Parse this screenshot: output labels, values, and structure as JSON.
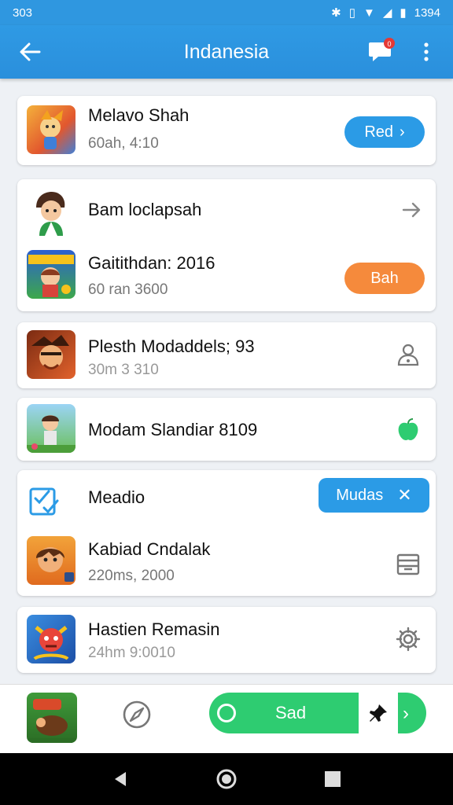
{
  "status_bar": {
    "time": "303",
    "clock": "1394"
  },
  "app_bar": {
    "title": "Indanesia",
    "badge_count": "0"
  },
  "items": [
    {
      "name": "Melavo Shah",
      "sub": "60ah, 4:10",
      "button": "Red"
    },
    {
      "name": "Bam loclapsah"
    },
    {
      "name": "Gaitithdan: 2016",
      "sub": "60 ran 3600",
      "button": "Bah"
    },
    {
      "name": "Plesth Modaddels; 93",
      "sub": "30m 3 310"
    },
    {
      "name": "Modam Slandiar 8109"
    },
    {
      "name": "Meadio",
      "button": "Mudas"
    },
    {
      "name": "Kabiad Cndalak",
      "sub": "220ms, 2000"
    },
    {
      "name": "Hastien Remasin",
      "sub": "24hm 9:0010"
    }
  ],
  "bottom": {
    "action_label": "Sad"
  },
  "colors": {
    "accent_blue": "#2f97e0",
    "orange": "#f58a3c",
    "green": "#2ecc71",
    "pill_blue": "#2b9be6"
  },
  "icons": [
    "back-arrow-icon",
    "chat-icon",
    "more-vert-icon",
    "chevron-right-icon",
    "person-icon",
    "green-apple-icon",
    "checklist-icon",
    "close-icon",
    "tray-icon",
    "gear-icon",
    "compass-icon",
    "pin-icon",
    "nav-back-icon",
    "nav-home-icon",
    "nav-recent-icon"
  ]
}
